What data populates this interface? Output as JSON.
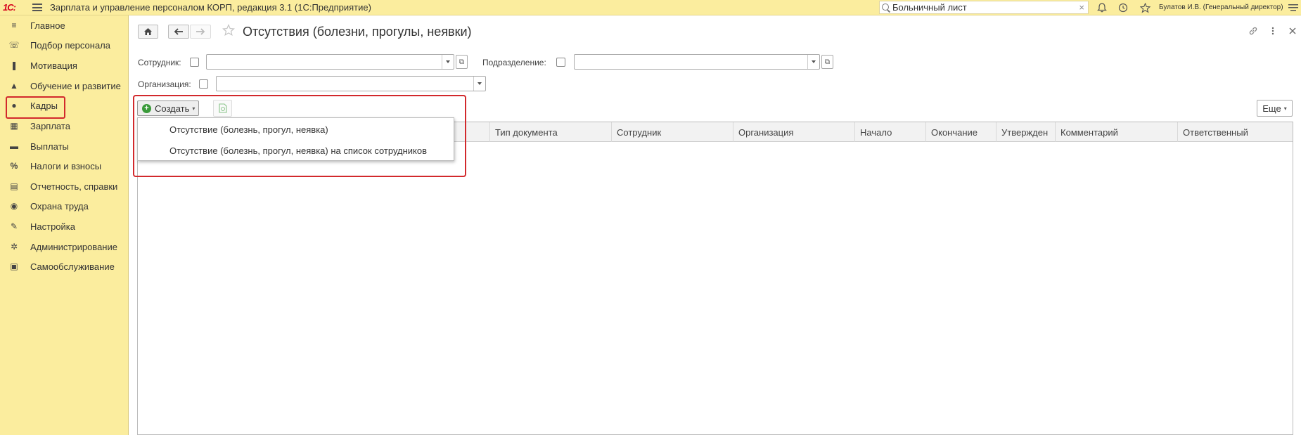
{
  "topbar": {
    "logo": "1С:",
    "app_title": "Зарплата и управление персоналом КОРП, редакция 3.1  (1С:Предприятие)",
    "search_value": "Больничный лист",
    "search_clear": "×",
    "user": "Булатов И.В. (Генеральный директор)"
  },
  "sidebar": {
    "items": [
      {
        "label": "Главное",
        "icon": "≡"
      },
      {
        "label": "Подбор персонала",
        "icon": "☏"
      },
      {
        "label": "Мотивация",
        "icon": "❚"
      },
      {
        "label": "Обучение и развитие",
        "icon": "▲"
      },
      {
        "label": "Кадры",
        "icon": "●"
      },
      {
        "label": "Зарплата",
        "icon": "▦"
      },
      {
        "label": "Выплаты",
        "icon": "▬"
      },
      {
        "label": "Налоги и взносы",
        "icon": "%"
      },
      {
        "label": "Отчетность, справки",
        "icon": "▤"
      },
      {
        "label": "Охрана труда",
        "icon": "◉"
      },
      {
        "label": "Настройка",
        "icon": "✎"
      },
      {
        "label": "Администрирование",
        "icon": "✲"
      },
      {
        "label": "Самообслуживание",
        "icon": "▣"
      }
    ]
  },
  "main": {
    "title": "Отсутствия (болезни, прогулы, неявки)",
    "filters": {
      "employee_label": "Сотрудник:",
      "department_label": "Подразделение:",
      "organization_label": "Организация:"
    },
    "create_label": "Создать",
    "more_label": "Еще",
    "columns": [
      "Тип документа",
      "Сотрудник",
      "Организация",
      "Начало",
      "Окончание",
      "Утвержден",
      "Комментарий",
      "Ответственный"
    ],
    "dropdown_items": [
      "Отсутствие (болезнь, прогул, неявка)",
      "Отсутствие (болезнь, прогул, неявка) на список сотрудников"
    ]
  },
  "colors": {
    "sidebar_bg": "#fbed9e",
    "highlight": "#d2292c"
  }
}
